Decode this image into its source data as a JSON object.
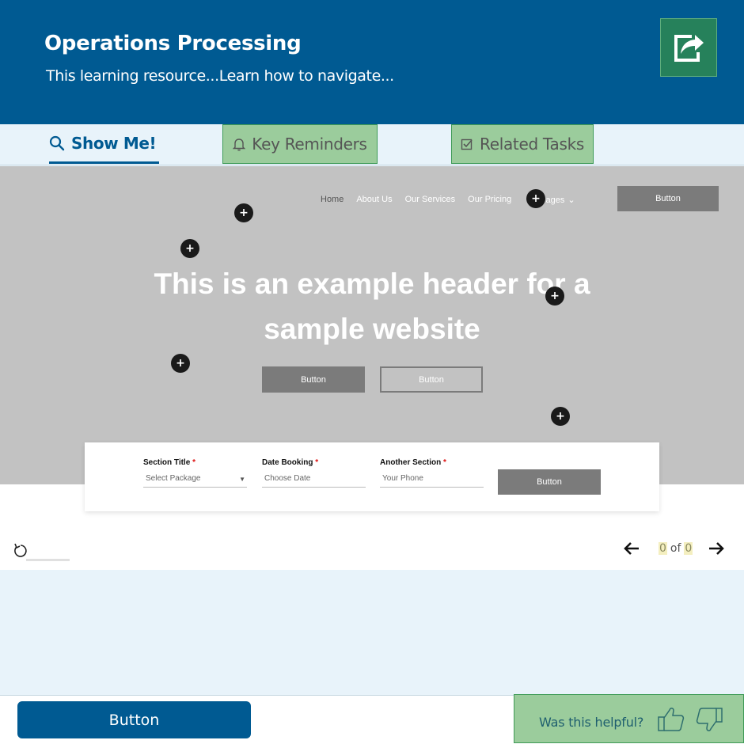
{
  "header": {
    "title": "Operations Processing",
    "subtitle": "This learning resource...Learn how to navigate...",
    "share_icon": "share-icon"
  },
  "tabs": {
    "show_me": "Show Me!",
    "key_reminders": "Key Reminders",
    "related_tasks": "Related Tasks"
  },
  "preview": {
    "nav": [
      "Home",
      "About Us",
      "Our Services",
      "Our Pricing",
      "Pages"
    ],
    "nav_button": "Button",
    "hero_title": "This is an example header for a sample website",
    "hero_button_primary": "Button",
    "hero_button_secondary": "Button",
    "form": {
      "fields": [
        {
          "label": "Section Title",
          "value": "Select Package"
        },
        {
          "label": "Date Booking",
          "value": "Choose Date"
        },
        {
          "label": "Another Section",
          "value": "Your Phone"
        }
      ],
      "required_mark": "*",
      "button": "Button"
    },
    "hotspot_symbol": "+"
  },
  "playback": {
    "current": "0",
    "of_label": "of",
    "total": "0"
  },
  "footer": {
    "button": "Button",
    "feedback_question": "Was this helpful?"
  },
  "colors": {
    "brand_blue": "#005a92",
    "highlight_green": "#9bcc9c",
    "share_green": "#26815b",
    "placeholder_gray": "#c2c2c2"
  }
}
